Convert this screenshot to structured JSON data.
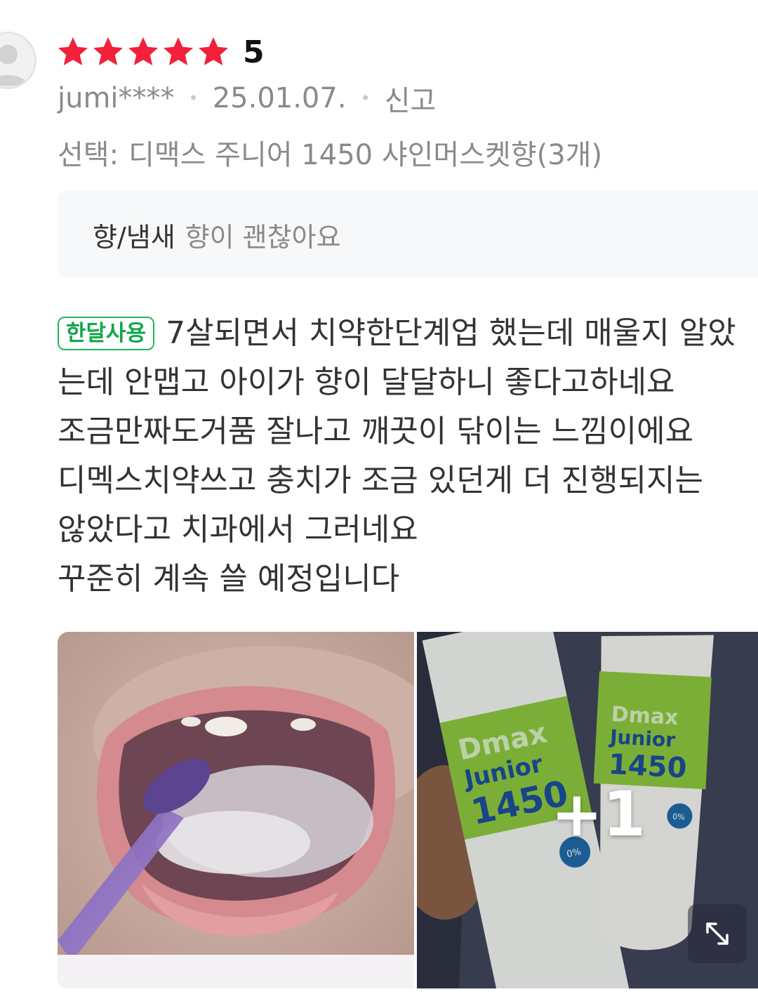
{
  "review": {
    "rating": {
      "stars_filled": 5,
      "stars_total": 5,
      "value_label": "5",
      "star_color": "#f2203a"
    },
    "author": "jumi****",
    "date": "25.01.07.",
    "report_label": "신고",
    "option": {
      "label": "선택:",
      "value": "디맥스 주니어 1450 샤인머스켓향(3개)"
    },
    "attribute": {
      "name": "향/냄새",
      "value": "향이 괜찮아요"
    },
    "usage_badge": "한달사용",
    "badge_color": "#13a64b",
    "body_lines": [
      "7살되면서 치약한단계업 했는데 매울지 알았",
      "는데 안맵고 아이가 향이 달달하니 좋다고하네요",
      "조금만짜도거품 잘나고 깨끗이 닦이는 느낌이에요",
      "디멕스치약쓰고 충치가 조금 있던게 더 진행되지는",
      "않았다고 치과에서 그러네요",
      "꾸준히 계속 쓸 예정입니다"
    ],
    "photos": {
      "product_brand": "Dmax",
      "product_line": "Junior",
      "product_number": "1450",
      "product_badge": "0%",
      "more_count_label": "+1",
      "accent_green": "#8cc63f"
    }
  }
}
